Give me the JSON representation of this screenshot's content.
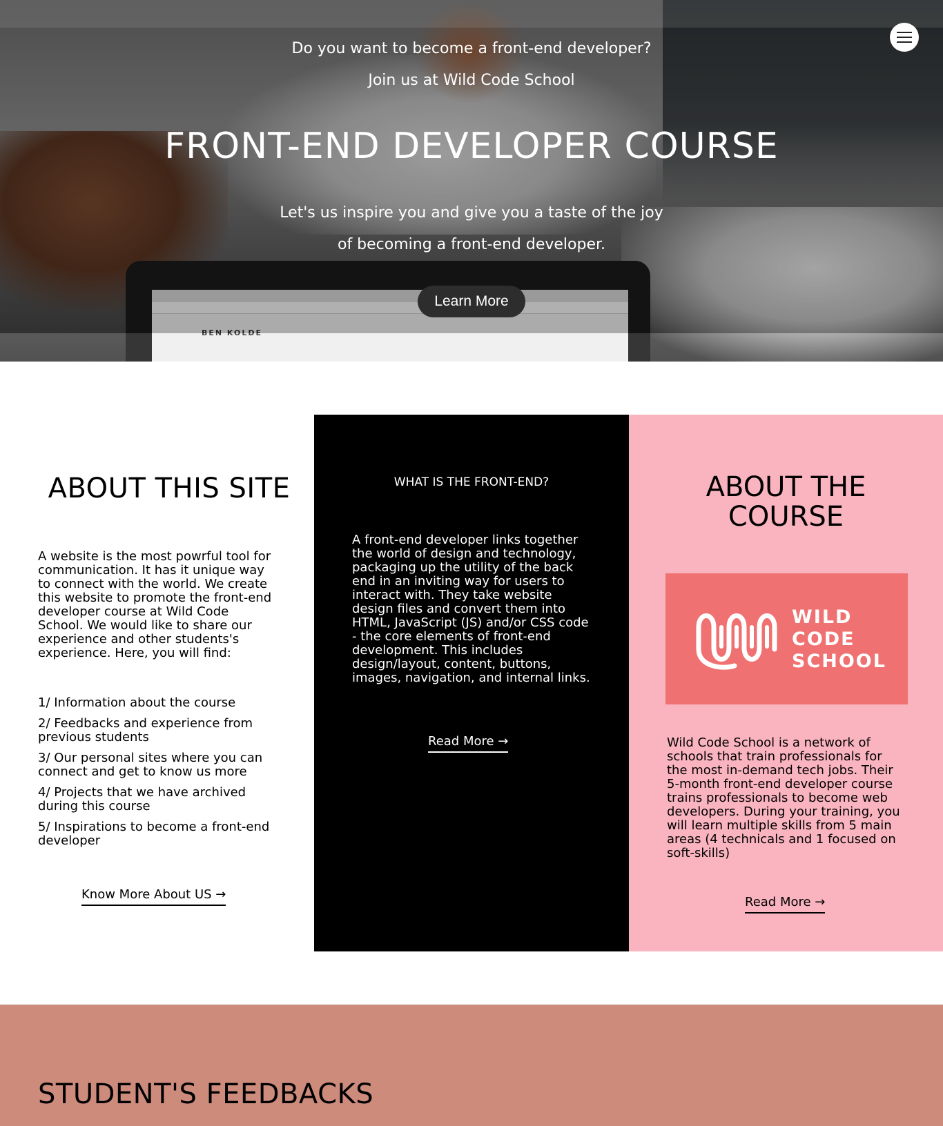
{
  "hero": {
    "line1": "Do you want to become a front-end developer?",
    "line2": "Join us at Wild Code School",
    "title": "FRONT-END DEVELOPER COURSE",
    "subtitle1": "Let's us inspire you and give you a taste of the joy",
    "subtitle2": "of becoming a front-end developer.",
    "cta_label": "Learn More",
    "laptop_site_text": "BEN KOLDE",
    "menu_icon": "hamburger-icon"
  },
  "about_site": {
    "heading": "ABOUT THIS SITE",
    "paragraph": "A website is the most powrful tool for communication. It has it unique way to connect with the world. We create this website to promote the front-end developer course at Wild Code School. We would like to share our experience and other students's experience. Here, you will find:",
    "items": [
      "1/ Information about the course",
      "2/ Feedbacks and experience from previous students",
      "3/ Our personal sites where you can connect and get to know us more",
      "4/ Projects that we have archived during this course",
      "5/ Inspirations to become a front-end developer"
    ],
    "link_label": "Know More About US →"
  },
  "front_end": {
    "heading": "WHAT IS THE FRONT-END?",
    "paragraph": "A front-end developer links together the world of design and technology, packaging up the utility of the back end in an inviting way for users to interact with. They take website design files and convert them into HTML, JavaScript (JS) and/or CSS code - the core elements of front-end development. This includes design/layout, content, buttons, images, navigation, and internal links.",
    "link_label": "Read More →"
  },
  "about_course": {
    "heading_line1": "ABOUT THE",
    "heading_line2": "COURSE",
    "logo_lines": [
      "WILD",
      "CODE",
      "SCHOOL"
    ],
    "paragraph": "Wild Code School is a network of schools that train professionals for the most in-demand tech jobs. Their 5-month front-end developer course trains professionals to become web developers. During your training, you will learn multiple skills from 5 main areas (4 technicals and 1 focused on soft-skills)",
    "link_label": "Read More →"
  },
  "feedback": {
    "heading": "STUDENT'S FEEDBACKS"
  },
  "colors": {
    "black_column": "#000000",
    "pink_column": "#f9b4bf",
    "logo_box": "#f07171",
    "feedback_band": "#cd8b7c",
    "cta_button": "#2d2d2d"
  }
}
